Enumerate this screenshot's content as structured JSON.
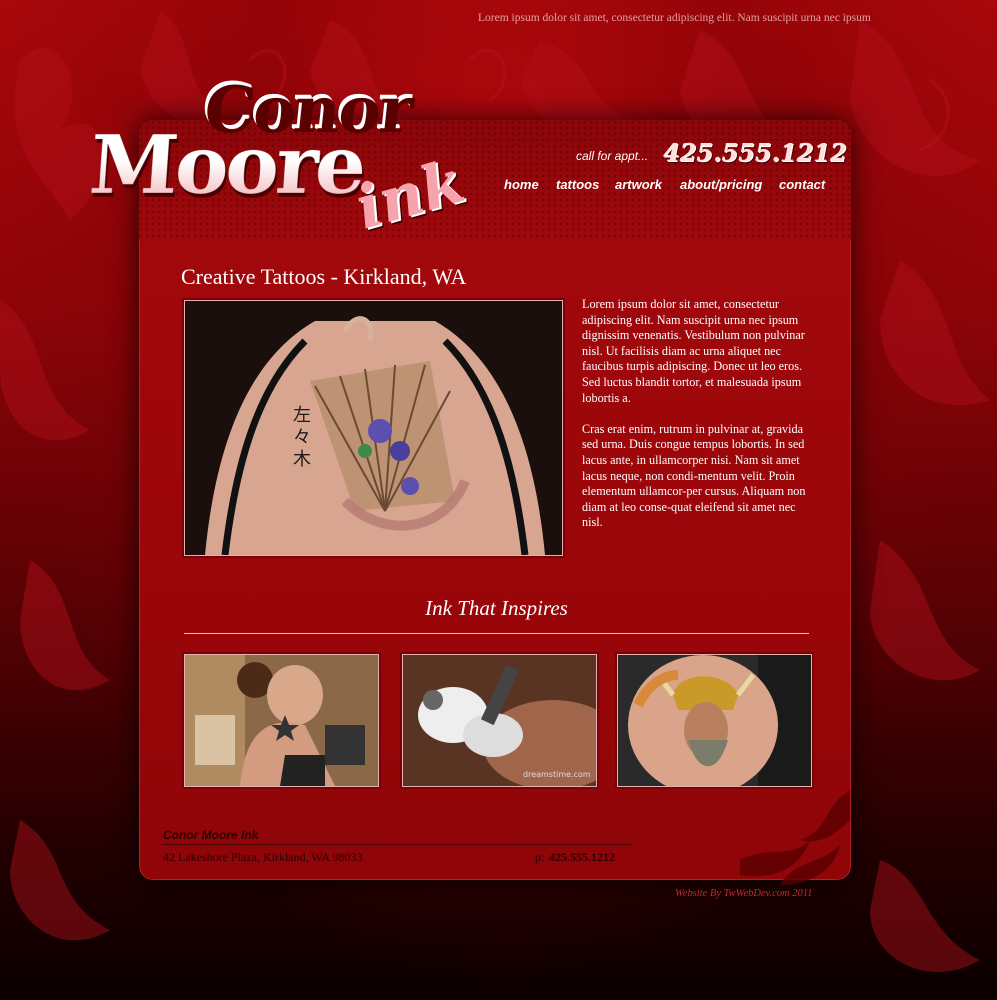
{
  "header": {
    "tagline": "Lorem ipsum dolor sit amet, consectetur adipiscing elit. Nam suscipit urna nec ipsum",
    "logo": {
      "line1": "Conor",
      "line2": "Moore",
      "line3": "ink"
    },
    "call_label": "call for appt...",
    "phone": "425.555.1212"
  },
  "nav": {
    "items": [
      {
        "label": "home"
      },
      {
        "label": "tattoos"
      },
      {
        "label": "artwork"
      },
      {
        "label": "about/pricing"
      },
      {
        "label": "contact"
      }
    ]
  },
  "main": {
    "heading": "Creative Tattoos - Kirkland, WA",
    "hero_image": "back-fan-tattoo-photo",
    "paragraphs": [
      "Lorem ipsum dolor sit amet, consectetur adipiscing elit. Nam suscipit urna nec ipsum dignissim venenatis. Vestibulum non pulvinar nisl. Ut facilisis diam ac urna aliquet nec faucibus turpis adipiscing. Donec ut leo eros. Sed luctus blandit tortor, et malesuada ipsum lobortis a.",
      "Cras erat enim, rutrum in pulvinar at, gravida sed urna. Duis congue tempus lobortis. In sed lacus ante, in ullamcorper nisi. Nam sit amet lacus neque, non condi-mentum velit. Proin elementum ullamcor-per cursus. Aliquam non diam at leo conse-quat eleifend sit amet nec nisl."
    ]
  },
  "gallery": {
    "title": "Ink That Inspires",
    "thumbnails": [
      {
        "image": "woman-shoulder-star-tattoo-photo"
      },
      {
        "image": "tattoo-artist-gloved-hands-photo",
        "watermark": "dreamstime.com"
      },
      {
        "image": "viking-forearm-tattoo-photo"
      }
    ]
  },
  "footer": {
    "name": "Conor Moore Ink",
    "address": "42 Lakeshore Plaza,  Kirkland, WA  98033",
    "phone_label": "p:",
    "phone": "425.555.1212",
    "credit": "Website By TwWebDev.com 2011"
  },
  "colors": {
    "background": "#8e0408",
    "panel": "#a3090d",
    "accent_pink": "#f7a3ad",
    "credit": "#c2272b"
  }
}
